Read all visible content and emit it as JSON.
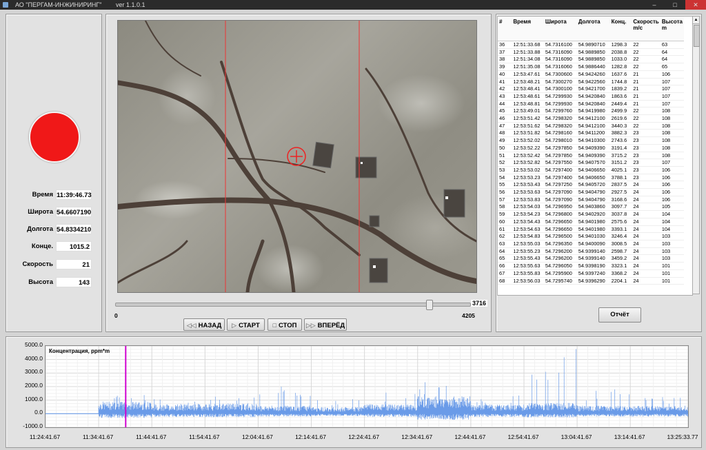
{
  "window": {
    "title": "АО \"ПЕРГАМ-ИНЖИНИРИНГ\"",
    "version": "ver  1.1.0.1",
    "minimize": "–",
    "maximize": "□",
    "close": "✕"
  },
  "left": {
    "indicator_color": "#f01818",
    "fields": [
      {
        "label": "Время",
        "value": "11:39:46.73"
      },
      {
        "label": "Широта",
        "value": "54.6607190"
      },
      {
        "label": "Долгота",
        "value": "54.8334210"
      },
      {
        "label": "Конце.",
        "value": "1015.2"
      },
      {
        "label": "Скорость",
        "value": "21"
      },
      {
        "label": "Высота",
        "value": "143"
      }
    ]
  },
  "player": {
    "slider_min": "0",
    "slider_max": "4205",
    "slider_current": "3716",
    "buttons": {
      "back": "НАЗАД",
      "start": "СТАРТ",
      "stop": "СТОП",
      "forward": "ВПЕРЁД"
    }
  },
  "table": {
    "headers": [
      "#",
      "Время",
      "Широта",
      "Долгота",
      "Конц.",
      "Скорость m/c",
      "Высота m"
    ],
    "rows": [
      [
        "36",
        "12:51:33.68",
        "54.7316100",
        "54.9890710",
        "1298.3",
        "22",
        "63"
      ],
      [
        "37",
        "12:51:33.88",
        "54.7316090",
        "54.9889850",
        "2038.8",
        "22",
        "64"
      ],
      [
        "38",
        "12:51:34.08",
        "54.7316090",
        "54.9889850",
        "1033.0",
        "22",
        "64"
      ],
      [
        "39",
        "12:51:35.08",
        "54.7316060",
        "54.9886440",
        "1282.8",
        "22",
        "65"
      ],
      [
        "40",
        "12:53:47.61",
        "54.7300600",
        "54.9424260",
        "1637.6",
        "21",
        "106"
      ],
      [
        "41",
        "12:53:48.21",
        "54.7300270",
        "54.9422560",
        "1744.8",
        "21",
        "107"
      ],
      [
        "42",
        "12:53:48.41",
        "54.7300100",
        "54.9421700",
        "1839.2",
        "21",
        "107"
      ],
      [
        "43",
        "12:53:48.61",
        "54.7299930",
        "54.9420840",
        "1863.6",
        "21",
        "107"
      ],
      [
        "44",
        "12:53:48.81",
        "54.7299930",
        "54.9420840",
        "2449.4",
        "21",
        "107"
      ],
      [
        "45",
        "12:53:49.01",
        "54.7299760",
        "54.9419980",
        "2499.9",
        "22",
        "108"
      ],
      [
        "46",
        "12:53:51.42",
        "54.7298320",
        "54.9412100",
        "2619.6",
        "22",
        "108"
      ],
      [
        "47",
        "12:53:51.62",
        "54.7298320",
        "54.9412100",
        "3440.3",
        "22",
        "108"
      ],
      [
        "48",
        "12:53:51.82",
        "54.7298160",
        "54.9411200",
        "3882.3",
        "23",
        "108"
      ],
      [
        "49",
        "12:53:52.02",
        "54.7298010",
        "54.9410300",
        "2743.6",
        "23",
        "108"
      ],
      [
        "50",
        "12:53:52.22",
        "54.7297850",
        "54.9409390",
        "3191.4",
        "23",
        "108"
      ],
      [
        "51",
        "12:53:52.42",
        "54.7297850",
        "54.9409390",
        "3715.2",
        "23",
        "108"
      ],
      [
        "52",
        "12:53:52.82",
        "54.7297550",
        "54.9407570",
        "3151.2",
        "23",
        "107"
      ],
      [
        "53",
        "12:53:53.02",
        "54.7297400",
        "54.9406650",
        "4025.1",
        "23",
        "106"
      ],
      [
        "54",
        "12:53:53.23",
        "54.7297400",
        "54.9406650",
        "3788.1",
        "23",
        "106"
      ],
      [
        "55",
        "12:53:53.43",
        "54.7297250",
        "54.9405720",
        "2837.5",
        "24",
        "106"
      ],
      [
        "56",
        "12:53:53.63",
        "54.7297090",
        "54.9404790",
        "2927.5",
        "24",
        "106"
      ],
      [
        "57",
        "12:53:53.83",
        "54.7297090",
        "54.9404790",
        "3168.6",
        "24",
        "106"
      ],
      [
        "58",
        "12:53:54.03",
        "54.7296950",
        "54.9403860",
        "3097.7",
        "24",
        "105"
      ],
      [
        "59",
        "12:53:54.23",
        "54.7296800",
        "54.9402920",
        "3037.8",
        "24",
        "104"
      ],
      [
        "60",
        "12:53:54.43",
        "54.7296650",
        "54.9401980",
        "2575.6",
        "24",
        "104"
      ],
      [
        "61",
        "12:53:54.63",
        "54.7296650",
        "54.9401980",
        "3393.1",
        "24",
        "104"
      ],
      [
        "62",
        "12:53:54.83",
        "54.7296500",
        "54.9401030",
        "3246.4",
        "24",
        "103"
      ],
      [
        "63",
        "12:53:55.03",
        "54.7296350",
        "54.9400090",
        "3008.5",
        "24",
        "103"
      ],
      [
        "64",
        "12:53:55.23",
        "54.7296200",
        "54.9399140",
        "2598.7",
        "24",
        "103"
      ],
      [
        "65",
        "12:53:55.43",
        "54.7296200",
        "54.9399140",
        "3459.2",
        "24",
        "103"
      ],
      [
        "66",
        "12:53:55.63",
        "54.7296050",
        "54.9398190",
        "3323.1",
        "24",
        "101"
      ],
      [
        "67",
        "12:53:55.83",
        "54.7295900",
        "54.9397240",
        "3368.2",
        "24",
        "101"
      ],
      [
        "68",
        "12:53:56.03",
        "54.7295740",
        "54.9396290",
        "2204.1",
        "24",
        "101"
      ]
    ]
  },
  "report_button": "Отчёт",
  "chart_data": {
    "type": "line",
    "title": "Концентрация, ppm*m",
    "y_ticks": [
      "5000.0",
      "4000.0",
      "3000.0",
      "2000.0",
      "1000.0",
      "0.0",
      "-1000.0"
    ],
    "ylim": [
      -1000,
      5000
    ],
    "x_ticks": [
      "11:24:41.67",
      "11:34:41.67",
      "11:44:41.67",
      "11:54:41.67",
      "12:04:41.67",
      "12:14:41.67",
      "12:24:41.67",
      "12:34:41.67",
      "12:44:41.67",
      "12:54:41.67",
      "13:04:41.67",
      "13:14:41.67",
      "13:25:33.77"
    ],
    "series_color": "#6a9be8",
    "cursor_color": "#d000d0",
    "cursor_time": "11:39:46.73",
    "baseline_end": "11:34:41.67",
    "segments": [
      {
        "from": "11:34:41.67",
        "to": "11:44:41.67",
        "amp": 900,
        "peak": 1500
      },
      {
        "from": "11:44:41.67",
        "to": "11:54:41.67",
        "amp": 700,
        "peak": 1200
      },
      {
        "from": "11:54:41.67",
        "to": "12:04:41.67",
        "amp": 750,
        "peak": 1300
      },
      {
        "from": "12:04:41.67",
        "to": "12:14:41.67",
        "amp": 600,
        "peak": 2000
      },
      {
        "from": "12:14:41.67",
        "to": "12:24:41.67",
        "amp": 500,
        "peak": 1100
      },
      {
        "from": "12:24:41.67",
        "to": "12:34:41.67",
        "amp": 700,
        "peak": 1600
      },
      {
        "from": "12:34:41.67",
        "to": "12:44:41.67",
        "amp": 1300,
        "peak": 2500
      },
      {
        "from": "12:44:41.67",
        "to": "12:54:41.67",
        "amp": 700,
        "peak": 1500
      },
      {
        "from": "12:54:41.67",
        "to": "13:04:41.67",
        "amp": 800,
        "peak": 4800
      },
      {
        "from": "13:04:41.67",
        "to": "13:14:41.67",
        "amp": 600,
        "peak": 1800
      },
      {
        "from": "13:14:41.67",
        "to": "13:25:33.77",
        "amp": 600,
        "peak": 1300
      }
    ]
  }
}
